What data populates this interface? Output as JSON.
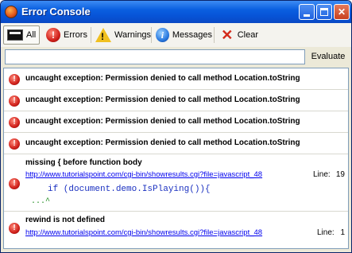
{
  "window": {
    "title": "Error Console",
    "min_glyph": "_",
    "max_glyph": "□",
    "close_glyph": "✕"
  },
  "toolbar": {
    "all_label": "All",
    "errors_label": "Errors",
    "warnings_label": "Warnings",
    "messages_label": "Messages",
    "clear_label": "Clear",
    "active": "all"
  },
  "evaluate": {
    "value": "",
    "button_label": "Evaluate"
  },
  "entries": [
    {
      "type": "error",
      "message": "uncaught exception: Permission denied to call method Location.toString"
    },
    {
      "type": "error",
      "message": "uncaught exception: Permission denied to call method Location.toString"
    },
    {
      "type": "error",
      "message": "uncaught exception: Permission denied to call method Location.toString"
    },
    {
      "type": "error",
      "message": "uncaught exception: Permission denied to call method Location.toString"
    },
    {
      "type": "error",
      "message": "missing { before function body",
      "source": "http://www.tutorialspoint.com/cgi-bin/showresults.cgi?file=javascript_48",
      "line_label": "Line:",
      "line": "19",
      "code": "if (document.demo.IsPlaying()){",
      "caret": "...^"
    },
    {
      "type": "error",
      "message": "rewind is not defined",
      "source": "http://www.tutorialspoint.com/cgi-bin/showresults.cgi?file=javascript_48",
      "line_label": "Line:",
      "line": "1"
    }
  ],
  "icons": {
    "error_glyph": "!",
    "warning_glyph": "!",
    "message_glyph": "i",
    "clear_glyph": "✕"
  },
  "colors": {
    "titlebar": "#0a5fe0",
    "link": "#0000ee",
    "code": "#1a30c0",
    "error": "#d0201a"
  }
}
